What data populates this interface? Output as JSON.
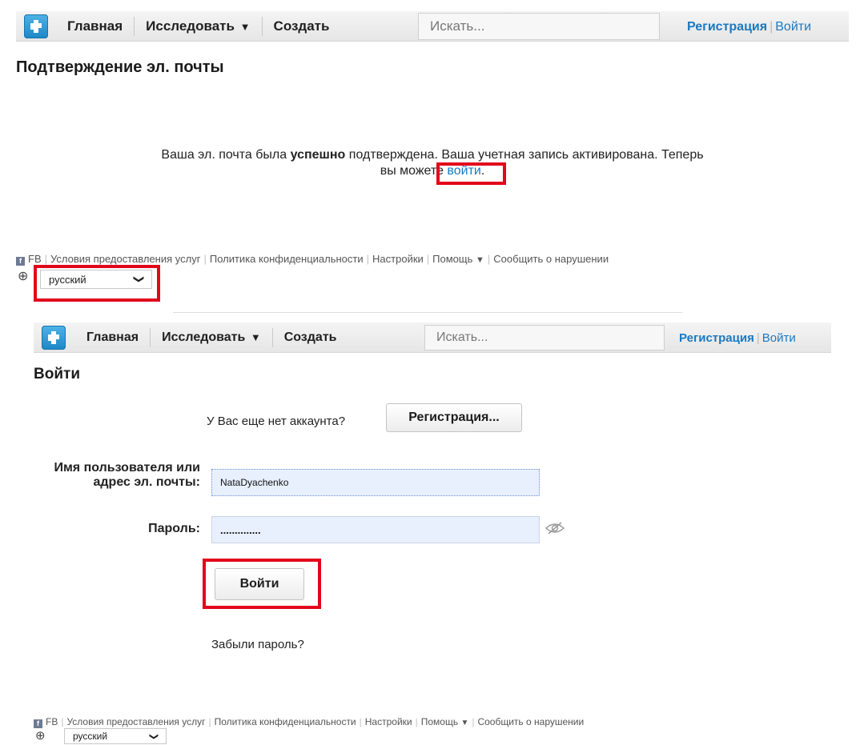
{
  "nav": {
    "home": "Главная",
    "explore": "Исследовать",
    "create": "Создать",
    "search_placeholder": "Искать...",
    "register": "Регистрация",
    "login": "Войти"
  },
  "confirm": {
    "title": "Подтверждение эл. почты",
    "msg_part1": "Ваша эл. почта была ",
    "msg_bold": "успешно",
    "msg_part2": " подтверждена. Ваша учетная запись активирована. Теперь",
    "msg_line2": "вы можете ",
    "msg_link": "войти",
    "msg_end": "."
  },
  "footer": {
    "fb_icon": "f",
    "fb": "FB",
    "terms": "Условия предоставления услуг",
    "privacy": "Политика конфиденциальности",
    "settings": "Настройки",
    "help": "Помощь",
    "report": "Сообщить о нарушении",
    "language": "русский"
  },
  "login": {
    "title": "Войти",
    "no_account": "У Вас еще нет аккаунта?",
    "register_button": "Регистрация...",
    "username_label": "Имя пользователя или адрес эл. почты:",
    "username_value": "NataDyachenko",
    "password_label": "Пароль:",
    "password_value": "..............",
    "submit_button": "Войти",
    "forgot": "Забыли пароль?"
  },
  "icons": {
    "globe": "⊕",
    "caret_down": "▼",
    "chevron_down": "❯",
    "eye_off": "⊘"
  },
  "colors": {
    "link": "#1a79c2",
    "highlight_box": "#e2061b",
    "input_bg": "#e8f0fe"
  }
}
